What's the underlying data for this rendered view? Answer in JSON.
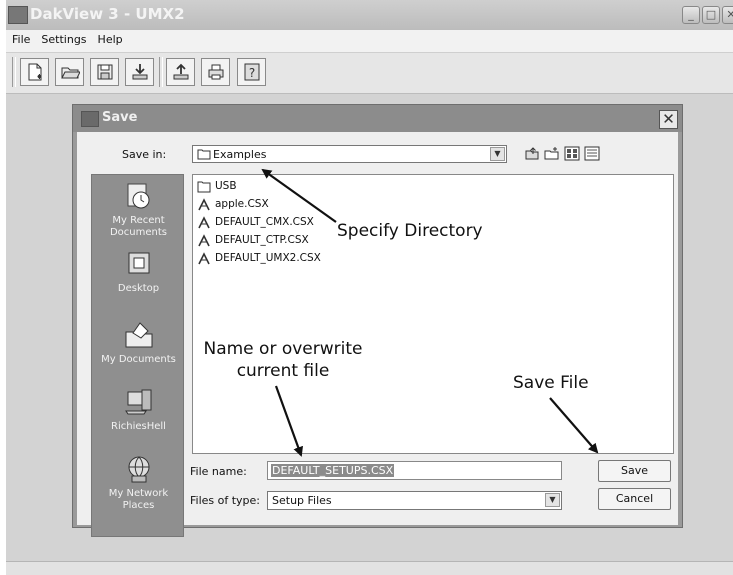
{
  "window": {
    "title": "DakView 3 - UMX2"
  },
  "menu": [
    "File",
    "Settings",
    "Help"
  ],
  "toolbar": [
    {
      "icon": "new-file-icon"
    },
    {
      "icon": "open-folder-icon"
    },
    {
      "icon": "save-disk-icon"
    },
    {
      "icon": "download-icon"
    },
    {
      "icon": "upload-icon"
    },
    {
      "icon": "print-icon"
    },
    {
      "icon": "help-icon",
      "label": "?"
    }
  ],
  "dialog": {
    "title": "Save",
    "close_glyph": "✕",
    "save_in_label": "Save in:",
    "save_in_value": "Examples",
    "places": [
      {
        "label": "My Recent Documents",
        "icon": "recent-documents-icon"
      },
      {
        "label": "Desktop",
        "icon": "desktop-icon"
      },
      {
        "label": "My Documents",
        "icon": "my-documents-icon"
      },
      {
        "label": "RichiesHell",
        "icon": "my-computer-icon"
      },
      {
        "label": "My Network Places",
        "icon": "network-places-icon"
      }
    ],
    "files": [
      {
        "name": "USB",
        "type": "folder"
      },
      {
        "name": "apple.CSX",
        "type": "file"
      },
      {
        "name": "DEFAULT_CMX.CSX",
        "type": "file"
      },
      {
        "name": "DEFAULT_CTP.CSX",
        "type": "file"
      },
      {
        "name": "DEFAULT_UMX2.CSX",
        "type": "file"
      }
    ],
    "file_name_label": "File name:",
    "file_name_value": "DEFAULT_SETUPS.CSX",
    "file_type_label": "Files of type:",
    "file_type_value": "Setup Files",
    "save_button": "Save",
    "cancel_button": "Cancel"
  },
  "annotations": {
    "specify_directory": "Specify Directory",
    "name_line1": "Name or overwrite",
    "name_line2": "current file",
    "save_file": "Save File"
  }
}
